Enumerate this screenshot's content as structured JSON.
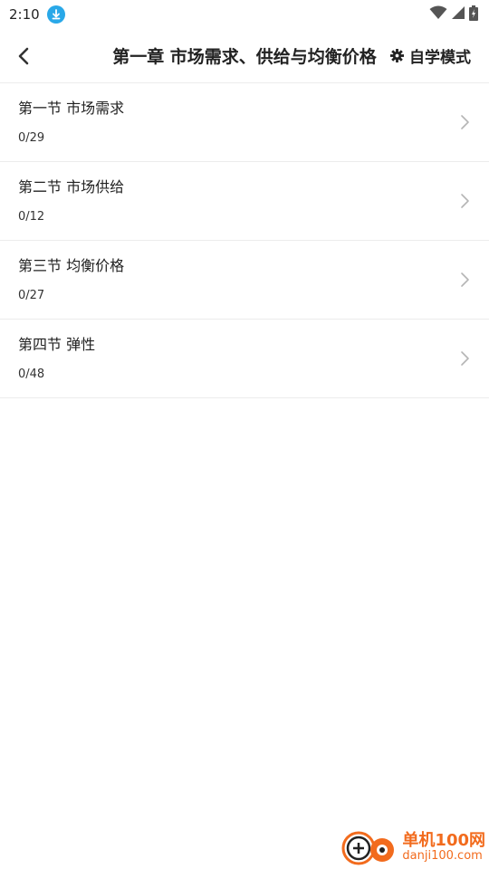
{
  "status_bar": {
    "time": "2:10"
  },
  "header": {
    "title": "第一章 市场需求、供给与均衡价格",
    "mode_label": "自学模式"
  },
  "sections": [
    {
      "title": "第一节 市场需求",
      "progress": "0/29"
    },
    {
      "title": "第二节 市场供给",
      "progress": "0/12"
    },
    {
      "title": "第三节 均衡价格",
      "progress": "0/27"
    },
    {
      "title": "第四节 弹性",
      "progress": "0/48"
    }
  ],
  "watermark": {
    "cn": "单机100网",
    "en": "danji100.com"
  },
  "colors": {
    "accent_blue": "#29a8e8",
    "watermark_orange": "#f26b1d",
    "divider": "#ececec"
  }
}
